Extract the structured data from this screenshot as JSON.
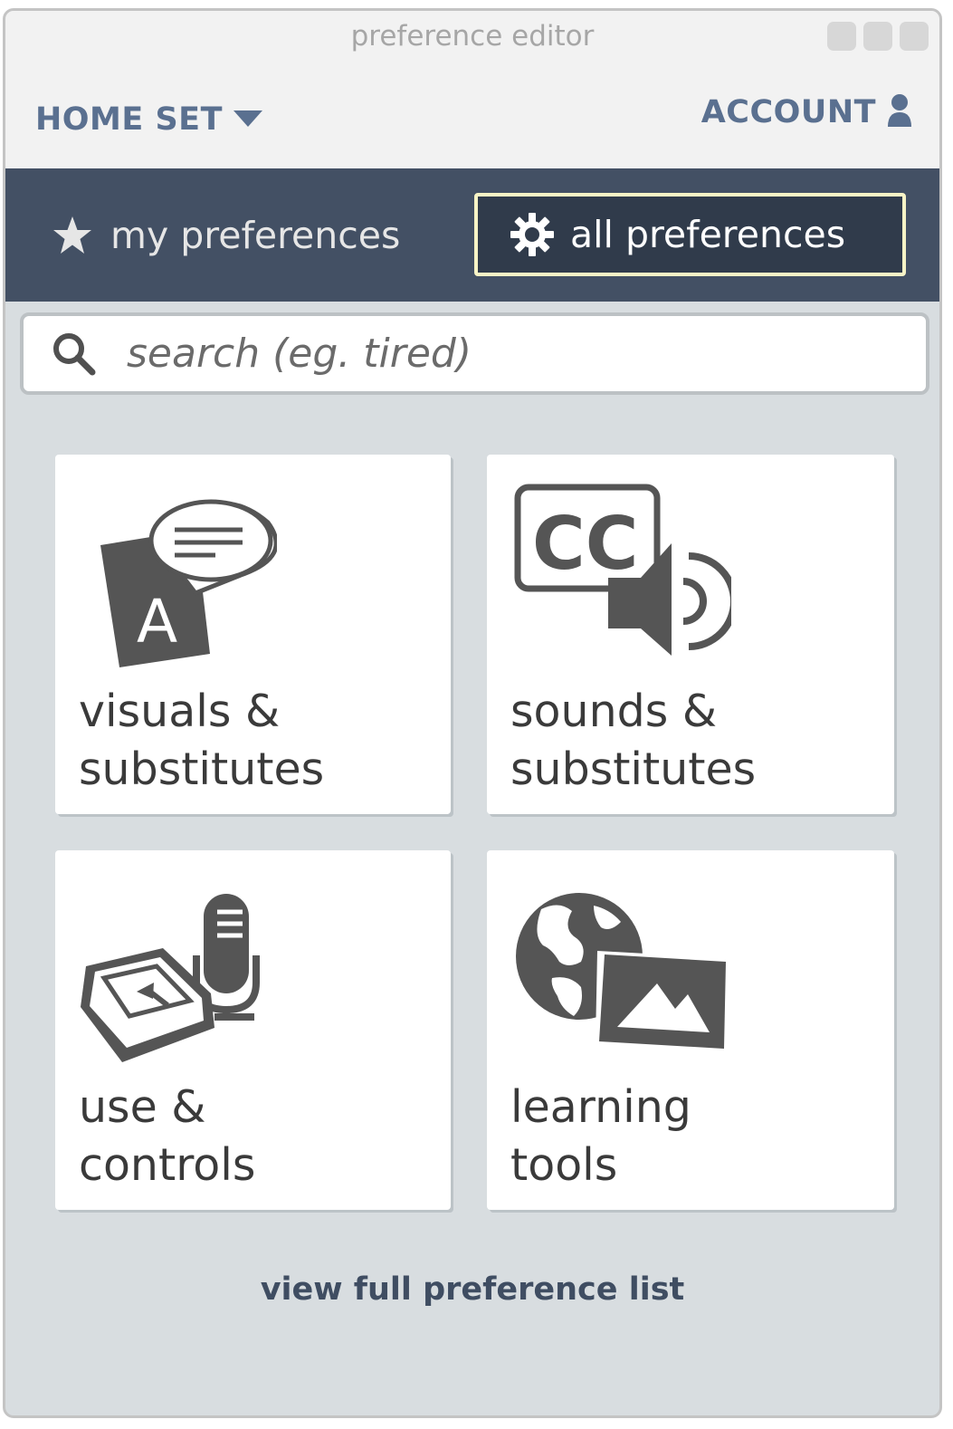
{
  "window": {
    "title": "preference editor"
  },
  "topbar": {
    "home_set": "HOME SET",
    "account": "ACCOUNT"
  },
  "tabs": {
    "my_preferences": "my preferences",
    "all_preferences": "all preferences",
    "active": "all preferences"
  },
  "search": {
    "placeholder": "search (eg. tired)"
  },
  "categories": [
    {
      "line1": "visuals &",
      "line2": "substitutes",
      "icon": "text-speech-bubble-icon"
    },
    {
      "line1": "sounds &",
      "line2": "substitutes",
      "icon": "captions-speaker-icon"
    },
    {
      "line1": "use &",
      "line2": "controls",
      "icon": "keyboard-microphone-icon"
    },
    {
      "line1": "learning",
      "line2": "tools",
      "icon": "globe-image-icon"
    }
  ],
  "footer": {
    "full_list_link": "view full preference list"
  },
  "colors": {
    "tab_bar": "#435064",
    "accent_border": "#f8f4c6",
    "link": "#5a7090",
    "background": "#d8dde0"
  }
}
